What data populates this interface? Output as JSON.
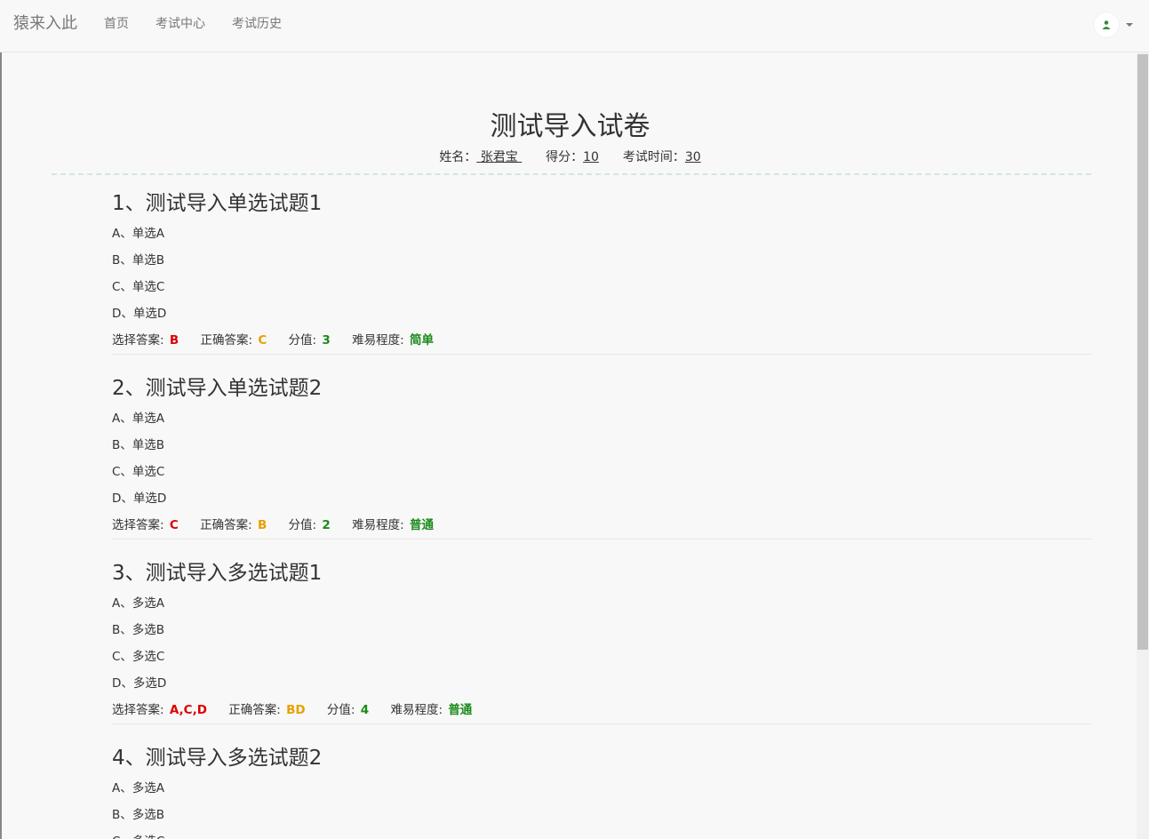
{
  "nav": {
    "brand": "猿来入此",
    "links": [
      "首页",
      "考试中心",
      "考试历史"
    ]
  },
  "paper": {
    "title": "测试导入试卷",
    "name_label": "姓名：",
    "name": " 张君宝 ",
    "score_label": "得分：",
    "score": "10",
    "time_label": "考试时间：",
    "time": "30"
  },
  "labels": {
    "selected": "选择答案:",
    "correct": "正确答案:",
    "points": "分值:",
    "difficulty": "难易程度:"
  },
  "questions": [
    {
      "title": "1、测试导入单选试题1",
      "options": [
        "A、单选A",
        "B、单选B",
        "C、单选C",
        "D、单选D"
      ],
      "selected": "B",
      "correct": "C",
      "points": "3",
      "difficulty": "简单"
    },
    {
      "title": "2、测试导入单选试题2",
      "options": [
        "A、单选A",
        "B、单选B",
        "C、单选C",
        "D、单选D"
      ],
      "selected": "C",
      "correct": "B",
      "points": "2",
      "difficulty": "普通"
    },
    {
      "title": "3、测试导入多选试题1",
      "options": [
        "A、多选A",
        "B、多选B",
        "C、多选C",
        "D、多选D"
      ],
      "selected": "A,C,D",
      "correct": "BD",
      "points": "4",
      "difficulty": "普通"
    },
    {
      "title": "4、测试导入多选试题2",
      "options": [
        "A、多选A",
        "B、多选B",
        "C、多选C"
      ]
    }
  ]
}
